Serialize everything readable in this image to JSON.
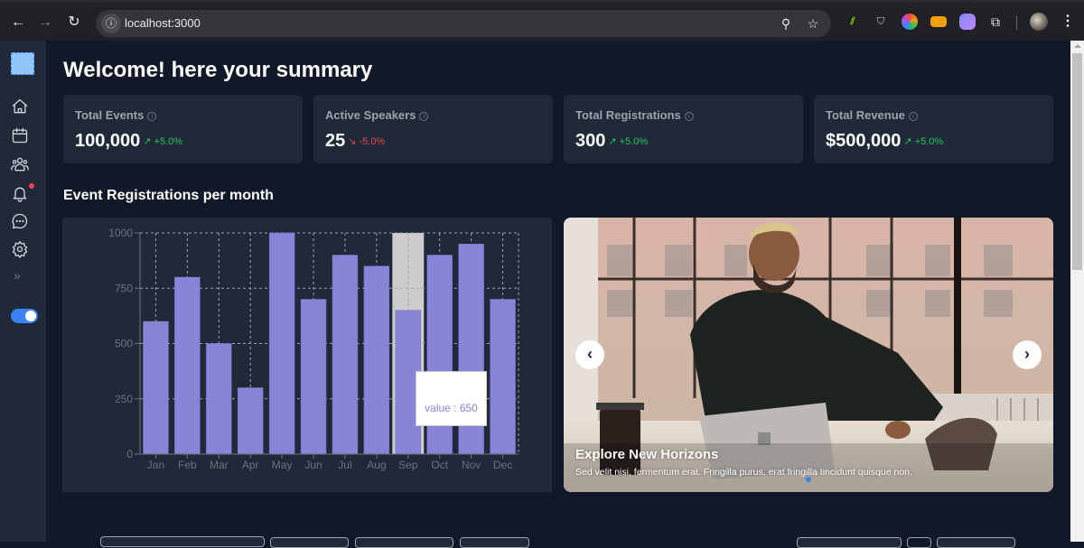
{
  "browser": {
    "url": "localhost:3000",
    "icons": [
      "back-icon",
      "forward-icon",
      "reload-icon",
      "site-info-icon",
      "zoom-icon",
      "bookmark-star-icon",
      "extensions-icon",
      "profile-avatar",
      "menu-icon"
    ]
  },
  "sidebar": {
    "items": [
      {
        "name": "home",
        "icon": "home-icon"
      },
      {
        "name": "calendar",
        "icon": "calendar-icon"
      },
      {
        "name": "users",
        "icon": "users-icon"
      },
      {
        "name": "notifications",
        "icon": "bell-icon",
        "badge": true
      },
      {
        "name": "messages",
        "icon": "chat-icon"
      },
      {
        "name": "settings",
        "icon": "gear-icon"
      }
    ],
    "expand_label": "»",
    "toggle_on": true
  },
  "header": {
    "title": "Welcome! here your summary"
  },
  "stats": [
    {
      "label": "Total Events",
      "value": "100,000",
      "trend": "↗ +5.0%",
      "direction": "up"
    },
    {
      "label": "Active Speakers",
      "value": "25",
      "trend": "↘ -5.0%",
      "direction": "down"
    },
    {
      "label": "Total Registrations",
      "value": "300",
      "trend": "↗ +5.0%",
      "direction": "up"
    },
    {
      "label": "Total Revenue",
      "value": "$500,000",
      "trend": "↗ +5.0%",
      "direction": "up"
    }
  ],
  "chart_section": {
    "title": "Event Registrations per month"
  },
  "chart_data": {
    "type": "bar",
    "title": "Event Registrations per month",
    "categories": [
      "Jan",
      "Feb",
      "Mar",
      "Apr",
      "May",
      "Jun",
      "Jul",
      "Aug",
      "Sep",
      "Oct",
      "Nov",
      "Dec"
    ],
    "values": [
      600,
      800,
      500,
      300,
      1000,
      700,
      900,
      850,
      650,
      900,
      950,
      700
    ],
    "yticks": [
      0,
      250,
      500,
      750,
      1000
    ],
    "ylim": [
      0,
      1000
    ],
    "xlabel": "",
    "ylabel": "",
    "grid": true,
    "bar_color": "#8884d8",
    "highlighted_category": "Sep",
    "tooltip": "value : 650"
  },
  "carousel": {
    "title": "Explore New Horizons",
    "description": "Sed velit nisi, fermentum erat. Fringilla purus, erat fringilla tincidunt quisque non.",
    "prev_label": "‹",
    "next_label": "›",
    "active_dot_color": "#3b82f6"
  },
  "info_glyph": "i"
}
